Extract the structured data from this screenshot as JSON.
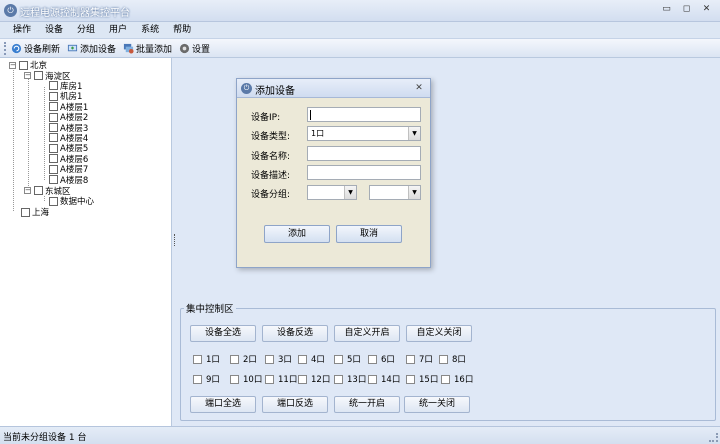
{
  "window": {
    "title": "远程电源控制器集控平台",
    "icon": "power-icon"
  },
  "menu": [
    "操作",
    "设备",
    "分组",
    "用户",
    "系统",
    "帮助"
  ],
  "toolbar": [
    {
      "label": "设备刷新",
      "icon": "refresh-icon",
      "color": "#3a7fd0"
    },
    {
      "label": "添加设备",
      "icon": "add-device-icon",
      "color": "#3c9a44"
    },
    {
      "label": "批量添加",
      "icon": "batch-add-icon",
      "color": "#c7583c"
    },
    {
      "label": "设置",
      "icon": "settings-icon",
      "color": "#6b6b6b"
    }
  ],
  "tree": {
    "root1": "北京",
    "haidian": "海淀区",
    "haidian_children": [
      "库房1",
      "机房1",
      "A楼层1",
      "A楼层2",
      "A楼层3",
      "A楼层4",
      "A楼层5",
      "A楼层6",
      "A楼层7",
      "A楼层8"
    ],
    "dongcheng": "东城区",
    "dongcheng_children": [
      "数据中心"
    ],
    "root2": "上海"
  },
  "dialog": {
    "title": "添加设备",
    "ip_label": "设备IP:",
    "ip_value": "",
    "type_label": "设备类型:",
    "type_value": "1口",
    "name_label": "设备名称:",
    "name_value": "",
    "desc_label": "设备描述:",
    "desc_value": "",
    "group_label": "设备分组:",
    "group1_value": "",
    "group2_value": "",
    "add_button": "添加",
    "cancel_button": "取消"
  },
  "control": {
    "title": "集中控制区",
    "top_buttons": [
      "设备全选",
      "设备反选",
      "自定义开启",
      "自定义关闭"
    ],
    "ports_row1": [
      "1口",
      "2口",
      "3口",
      "4口",
      "5口",
      "6口",
      "7口",
      "8口"
    ],
    "ports_row2": [
      "9口",
      "10口",
      "11口",
      "12口",
      "13口",
      "14口",
      "15口",
      "16口"
    ],
    "bottom_buttons": [
      "端口全选",
      "端口反选",
      "统一开启",
      "统一关闭"
    ]
  },
  "status": {
    "text": "当前未分组设备 1 台"
  }
}
